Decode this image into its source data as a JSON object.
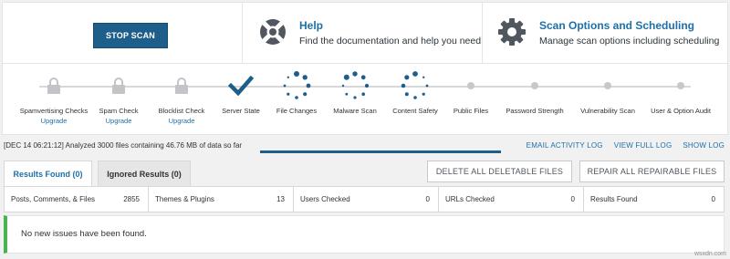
{
  "header": {
    "stop_scan_label": "STOP SCAN",
    "help": {
      "title": "Help",
      "description": "Find the documentation and help you need"
    },
    "options": {
      "title": "Scan Options and Scheduling",
      "description": "Manage scan options including scheduling"
    }
  },
  "stages": [
    {
      "label": "Spamvertising Checks",
      "sub": "Upgrade",
      "state": "locked"
    },
    {
      "label": "Spam Check",
      "sub": "Upgrade",
      "state": "locked"
    },
    {
      "label": "Blocklist Check",
      "sub": "Upgrade",
      "state": "locked"
    },
    {
      "label": "Server State",
      "sub": "",
      "state": "complete"
    },
    {
      "label": "File Changes",
      "sub": "",
      "state": "running"
    },
    {
      "label": "Malware Scan",
      "sub": "",
      "state": "running"
    },
    {
      "label": "Content Safety",
      "sub": "",
      "state": "running"
    },
    {
      "label": "Public Files",
      "sub": "",
      "state": "pending"
    },
    {
      "label": "Password Strength",
      "sub": "",
      "state": "pending"
    },
    {
      "label": "Vulnerability Scan",
      "sub": "",
      "state": "pending"
    },
    {
      "label": "User & Option Audit",
      "sub": "",
      "state": "pending"
    }
  ],
  "status": {
    "message": "[DEC 14 06:21:12] Analyzed 3000 files containing 46.76 MB of data so far",
    "links": {
      "email_log": "EMAIL ACTIVITY LOG",
      "full_log": "VIEW FULL LOG",
      "show_log": "SHOW LOG"
    }
  },
  "tabs": {
    "found": "Results Found (0)",
    "ignored": "Ignored Results (0)"
  },
  "actions": {
    "delete_all": "DELETE ALL DELETABLE FILES",
    "repair_all": "REPAIR ALL REPAIRABLE FILES"
  },
  "stats": [
    {
      "label": "Posts, Comments, & Files",
      "value": "2855"
    },
    {
      "label": "Themes & Plugins",
      "value": "13"
    },
    {
      "label": "Users Checked",
      "value": "0"
    },
    {
      "label": "URLs Checked",
      "value": "0"
    },
    {
      "label": "Results Found",
      "value": "0"
    }
  ],
  "notice": "No new issues have been found.",
  "watermark": "wsxdn.com",
  "colors": {
    "primary": "#1d5f8a",
    "link": "#1e6fa8",
    "success": "#46b450",
    "spinner": "#1d5f8a"
  }
}
